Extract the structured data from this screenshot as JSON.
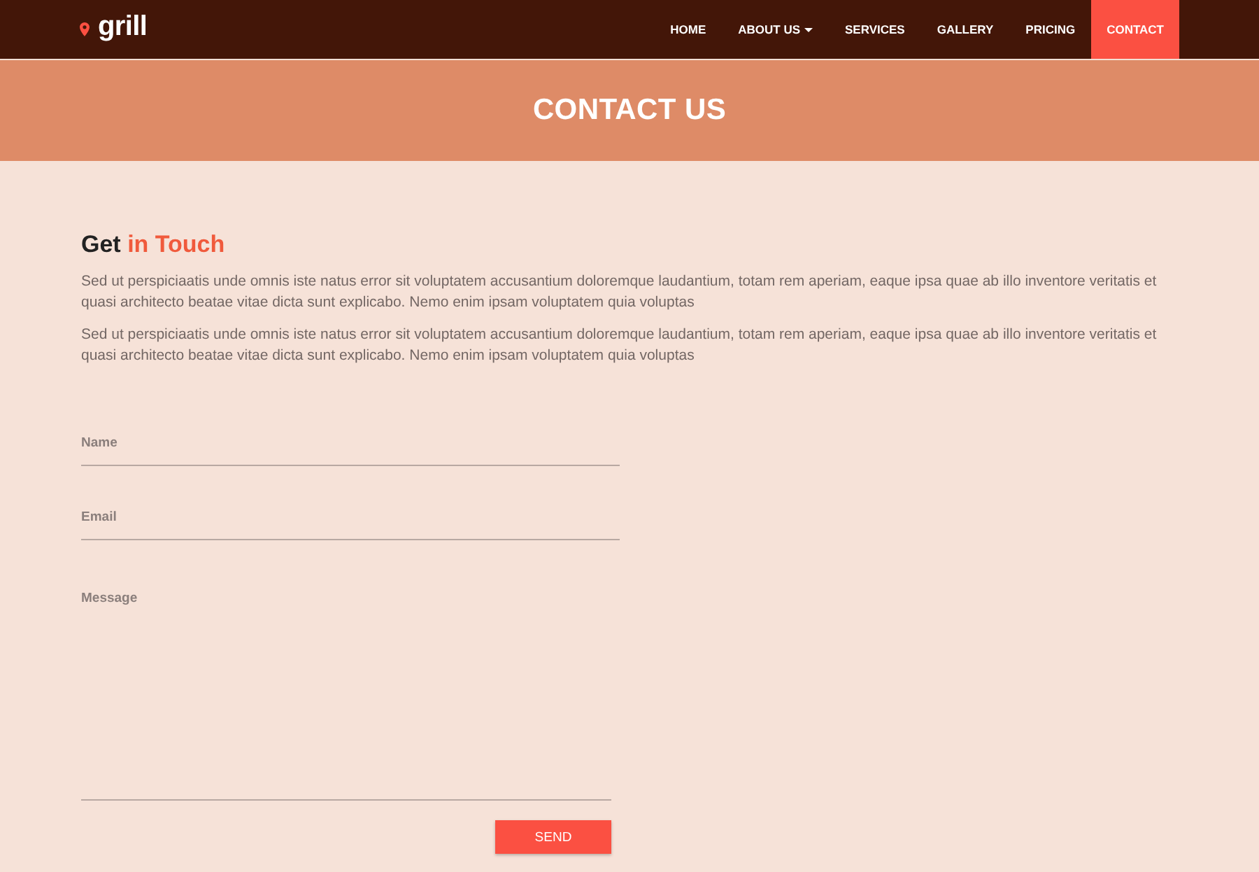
{
  "navbar": {
    "logo": "grill",
    "items": [
      {
        "label": "HOME",
        "selected": false,
        "dropdown": false
      },
      {
        "label": "ABOUT US",
        "selected": false,
        "dropdown": true
      },
      {
        "label": "SERVICES",
        "selected": false,
        "dropdown": false
      },
      {
        "label": "GALLERY",
        "selected": false,
        "dropdown": false
      },
      {
        "label": "PRICING",
        "selected": false,
        "dropdown": false
      },
      {
        "label": "CONTACT",
        "selected": true,
        "dropdown": false
      }
    ]
  },
  "banner": {
    "title": "CONTACT US"
  },
  "intro": {
    "heading_lead": "Get",
    "heading_accent": "in Touch",
    "paragraphs": [
      "Sed ut perspiciaatis unde omnis iste natus error sit voluptatem accusantium doloremque laudantium, totam rem aperiam, eaque ipsa quae ab illo inventore veritatis et quasi architecto beatae vitae dicta sunt explicabo. Nemo enim ipsam voluptatem quia voluptas",
      "Sed ut perspiciaatis unde omnis iste natus error sit voluptatem accusantium doloremque laudantium, totam rem aperiam, eaque ipsa quae ab illo inventore veritatis et quasi architecto beatae vitae dicta sunt explicabo. Nemo enim ipsam voluptatem quia voluptas"
    ]
  },
  "form": {
    "fields": [
      {
        "kind": "line",
        "placeholder": "Name"
      },
      {
        "kind": "line",
        "placeholder": "Email"
      },
      {
        "kind": "area",
        "placeholder": "Message"
      }
    ],
    "submit": "SEND"
  }
}
